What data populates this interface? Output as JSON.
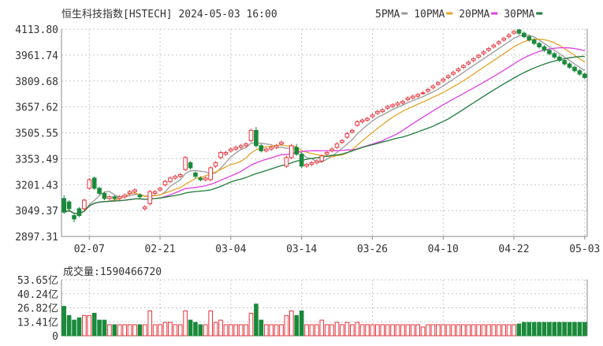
{
  "title": "恒生科技指数[HSTECH] 2024-05-03 16:00",
  "colors": {
    "up": "#e8333a",
    "down": "#1a8a3a",
    "grid": "#c8c8c8",
    "ma5": "#9b9b9b",
    "ma10": "#e5a52b",
    "ma20": "#e040e0",
    "ma30": "#1f7a3a"
  },
  "legend": [
    {
      "label": "5PMA",
      "color": "#9b9b9b"
    },
    {
      "label": "10PMA",
      "color": "#e5a52b"
    },
    {
      "label": "20PMA",
      "color": "#e040e0"
    },
    {
      "label": "30PMA",
      "color": "#1f7a3a"
    }
  ],
  "volume_label": "成交量:1590466720",
  "chart_data": [
    {
      "type": "candlestick",
      "title": "恒生科技指数[HSTECH] 2024-05-03 16:00",
      "ylim": [
        2897.31,
        4113.8
      ],
      "y_ticks": [
        "4113.80",
        "3961.74",
        "3809.68",
        "3657.62",
        "3505.55",
        "3353.49",
        "3201.43",
        "3049.37",
        "2897.31"
      ],
      "x_ticks": [
        {
          "label": "02-07",
          "index": 5
        },
        {
          "label": "02-21",
          "index": 19
        },
        {
          "label": "03-04",
          "index": 33
        },
        {
          "label": "03-14",
          "index": 47
        },
        {
          "label": "03-26",
          "index": 61
        },
        {
          "label": "04-10",
          "index": 75
        },
        {
          "label": "04-22",
          "index": 89
        },
        {
          "label": "05-03",
          "index": 103
        }
      ],
      "grid": true,
      "legend_position": "top-right",
      "candles": [
        [
          3120,
          3040,
          3140,
          3030
        ],
        [
          3100,
          3060,
          3110,
          3040
        ],
        [
          3020,
          3000,
          3030,
          2980
        ],
        [
          3060,
          3020,
          3070,
          3010
        ],
        [
          3060,
          3110,
          3120,
          3050
        ],
        [
          3180,
          3230,
          3240,
          3170
        ],
        [
          3240,
          3180,
          3250,
          3170
        ],
        [
          3180,
          3150,
          3190,
          3140
        ],
        [
          3150,
          3120,
          3160,
          3110
        ],
        [
          3120,
          3130,
          3140,
          3110
        ],
        [
          3130,
          3120,
          3140,
          3110
        ],
        [
          3120,
          3130,
          3140,
          3110
        ],
        [
          3130,
          3140,
          3150,
          3120
        ],
        [
          3150,
          3160,
          3170,
          3140
        ],
        [
          3160,
          3170,
          3180,
          3150
        ],
        [
          3140,
          3130,
          3150,
          3120
        ],
        [
          3060,
          3070,
          3080,
          3050
        ],
        [
          3090,
          3160,
          3170,
          3080
        ],
        [
          3150,
          3160,
          3170,
          3140
        ],
        [
          3170,
          3180,
          3190,
          3160
        ],
        [
          3200,
          3220,
          3230,
          3190
        ],
        [
          3220,
          3240,
          3250,
          3210
        ],
        [
          3240,
          3250,
          3260,
          3230
        ],
        [
          3250,
          3260,
          3270,
          3240
        ],
        [
          3290,
          3360,
          3370,
          3280
        ],
        [
          3330,
          3300,
          3340,
          3290
        ],
        [
          3270,
          3250,
          3280,
          3240
        ],
        [
          3240,
          3230,
          3250,
          3220
        ],
        [
          3230,
          3240,
          3250,
          3220
        ],
        [
          3230,
          3300,
          3310,
          3220
        ],
        [
          3310,
          3330,
          3340,
          3300
        ],
        [
          3360,
          3390,
          3400,
          3350
        ],
        [
          3380,
          3390,
          3400,
          3370
        ],
        [
          3400,
          3410,
          3420,
          3390
        ],
        [
          3410,
          3420,
          3430,
          3400
        ],
        [
          3420,
          3430,
          3440,
          3410
        ],
        [
          3430,
          3440,
          3450,
          3420
        ],
        [
          3460,
          3520,
          3530,
          3450
        ],
        [
          3520,
          3430,
          3540,
          3420
        ],
        [
          3430,
          3400,
          3440,
          3390
        ],
        [
          3400,
          3410,
          3420,
          3390
        ],
        [
          3410,
          3420,
          3430,
          3400
        ],
        [
          3420,
          3430,
          3440,
          3410
        ],
        [
          3440,
          3450,
          3460,
          3430
        ],
        [
          3310,
          3360,
          3370,
          3300
        ],
        [
          3360,
          3430,
          3440,
          3350
        ],
        [
          3420,
          3380,
          3440,
          3370
        ],
        [
          3380,
          3310,
          3390,
          3300
        ],
        [
          3310,
          3320,
          3330,
          3300
        ],
        [
          3320,
          3330,
          3340,
          3310
        ],
        [
          3330,
          3340,
          3350,
          3320
        ],
        [
          3340,
          3370,
          3380,
          3330
        ],
        [
          3380,
          3390,
          3400,
          3370
        ],
        [
          3400,
          3410,
          3420,
          3390
        ],
        [
          3420,
          3440,
          3450,
          3410
        ],
        [
          3450,
          3460,
          3470,
          3440
        ],
        [
          3480,
          3500,
          3510,
          3470
        ],
        [
          3510,
          3520,
          3530,
          3500
        ],
        [
          3550,
          3570,
          3580,
          3540
        ],
        [
          3570,
          3580,
          3590,
          3560
        ],
        [
          3580,
          3590,
          3600,
          3570
        ],
        [
          3600,
          3610,
          3620,
          3590
        ],
        [
          3620,
          3630,
          3640,
          3610
        ],
        [
          3630,
          3640,
          3650,
          3620
        ],
        [
          3650,
          3660,
          3670,
          3640
        ],
        [
          3660,
          3670,
          3680,
          3650
        ],
        [
          3670,
          3680,
          3690,
          3660
        ],
        [
          3680,
          3690,
          3700,
          3670
        ],
        [
          3700,
          3710,
          3720,
          3690
        ],
        [
          3710,
          3720,
          3730,
          3700
        ],
        [
          3720,
          3730,
          3740,
          3710
        ],
        [
          3740,
          3740,
          3750,
          3730
        ],
        [
          3750,
          3760,
          3770,
          3740
        ],
        [
          3770,
          3780,
          3790,
          3760
        ],
        [
          3790,
          3800,
          3810,
          3780
        ],
        [
          3810,
          3820,
          3830,
          3800
        ],
        [
          3830,
          3840,
          3850,
          3820
        ],
        [
          3850,
          3860,
          3870,
          3840
        ],
        [
          3870,
          3880,
          3890,
          3860
        ],
        [
          3890,
          3900,
          3910,
          3880
        ],
        [
          3910,
          3920,
          3930,
          3900
        ],
        [
          3930,
          3940,
          3950,
          3920
        ],
        [
          3950,
          3960,
          3970,
          3940
        ],
        [
          3970,
          3980,
          3990,
          3960
        ],
        [
          3990,
          4000,
          4010,
          3980
        ],
        [
          4010,
          4020,
          4030,
          4000
        ],
        [
          4030,
          4040,
          4050,
          4020
        ],
        [
          4050,
          4060,
          4070,
          4040
        ],
        [
          4070,
          4080,
          4090,
          4060
        ],
        [
          4090,
          4100,
          4110,
          4080
        ],
        [
          4110,
          4090,
          4113,
          4080
        ],
        [
          4090,
          4070,
          4100,
          4060
        ],
        [
          4070,
          4050,
          4080,
          4040
        ],
        [
          4050,
          4030,
          4060,
          4020
        ],
        [
          4030,
          4010,
          4040,
          4000
        ],
        [
          4010,
          3990,
          4020,
          3980
        ],
        [
          3990,
          3970,
          4000,
          3960
        ],
        [
          3970,
          3950,
          3980,
          3940
        ],
        [
          3950,
          3930,
          3960,
          3920
        ],
        [
          3930,
          3910,
          3940,
          3900
        ],
        [
          3910,
          3890,
          3920,
          3880
        ],
        [
          3890,
          3870,
          3900,
          3860
        ],
        [
          3870,
          3850,
          3880,
          3840
        ],
        [
          3850,
          3830,
          3860,
          3820
        ]
      ]
    },
    {
      "type": "bar",
      "title": "成交量:1590466720",
      "ylim": [
        0,
        53.65
      ],
      "y_ticks": [
        "53.65亿",
        "40.24亿",
        "26.82亿",
        "13.41亿",
        "0"
      ]
    }
  ]
}
